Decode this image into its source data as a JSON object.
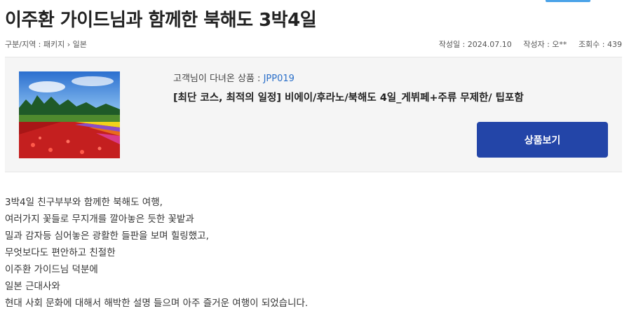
{
  "review": {
    "title": "이주환 가이드님과 함께한 북해도 3박4일",
    "category_label": "구분/지역 : ",
    "category_path": [
      "패키지",
      "일본"
    ],
    "created_date": "작성일 : 2024.07.10",
    "author": "작성자 : 오**",
    "views": "조회수 : 439"
  },
  "product": {
    "caption_label": "고객님이 다녀온 상품 : ",
    "code": "JPP019",
    "name": "[최단 코스, 최적의 일정] 비에이/후라노/북해도 4일_게뷔페+주류 무제한/ 팁포함",
    "view_button": "상품보기",
    "image_alt": "flower-field-photo"
  },
  "body": {
    "lines": [
      "3박4일 친구부부와 함께한 북해도 여행,",
      "여러가지 꽃들로 무지개를 깔아놓은 듯한 꽃밭과",
      "밀과 감자등 심어놓은 광활한 들판을 보며 힐링했고,",
      "무엇보다도 편안하고 친절한",
      "이주환 가이드님 덕분에",
      "일본 근대사와",
      "현대 사회 문화에 대해서 해박한 설명 들으며 아주 즐거운 여행이 되었습니다."
    ]
  },
  "colors": {
    "button": "#2345a8",
    "code_link": "#2a6fc9",
    "box_bg": "#f5f5f5"
  }
}
